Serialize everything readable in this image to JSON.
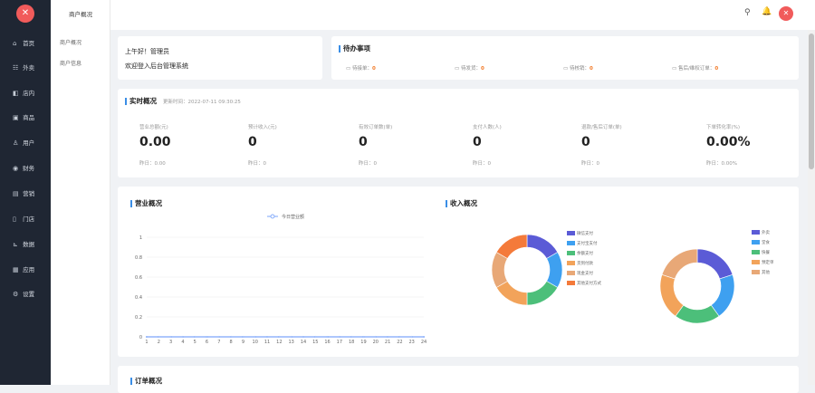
{
  "sidebar": {
    "logo_icon": "fork-knife-icon",
    "items": [
      {
        "label": "首页",
        "icon": "home-icon"
      },
      {
        "label": "外卖",
        "icon": "takeout-icon"
      },
      {
        "label": "店内",
        "icon": "store-icon"
      },
      {
        "label": "商品",
        "icon": "goods-icon"
      },
      {
        "label": "用户",
        "icon": "user-icon"
      },
      {
        "label": "财务",
        "icon": "finance-icon"
      },
      {
        "label": "营销",
        "icon": "marketing-icon"
      },
      {
        "label": "门店",
        "icon": "shop-icon"
      },
      {
        "label": "数据",
        "icon": "chart-icon"
      },
      {
        "label": "应用",
        "icon": "apps-icon"
      },
      {
        "label": "设置",
        "icon": "settings-icon"
      }
    ]
  },
  "subnav": {
    "title": "商户概况",
    "items": [
      "商户概况",
      "商户信息"
    ]
  },
  "topbar": {
    "icons": [
      "search-icon",
      "bell-icon",
      "avatar"
    ]
  },
  "welcome": {
    "greeting": "上午好！管理员",
    "message": "欢迎登入后台管理系统"
  },
  "todo": {
    "title": "待办事项",
    "items": [
      {
        "label": "待接单：",
        "value": "0"
      },
      {
        "label": "待发货：",
        "value": "0"
      },
      {
        "label": "待核销：",
        "value": "0"
      },
      {
        "label": "售后/维权订单：",
        "value": "0"
      }
    ]
  },
  "realtime": {
    "title": "实时概况",
    "updated": "更新时间：2022-07-11 09:30:25",
    "metrics": [
      {
        "label": "营业总额(元)",
        "value": "0.00",
        "compare": "昨日：0.00"
      },
      {
        "label": "预计收入(元)",
        "value": "0",
        "compare": "昨日：0"
      },
      {
        "label": "有效订单数(单)",
        "value": "0",
        "compare": "昨日：0"
      },
      {
        "label": "支付人数(人)",
        "value": "0",
        "compare": "昨日：0"
      },
      {
        "label": "退款/售后订单(单)",
        "value": "0",
        "compare": "昨日：0"
      },
      {
        "label": "下单转化率(%)",
        "value": "0.00%",
        "compare": "昨日：0.00%"
      }
    ]
  },
  "business": {
    "title": "营业概况"
  },
  "income": {
    "title": "收入概况"
  },
  "orders": {
    "title": "订单概况"
  },
  "chart_data": [
    {
      "type": "line",
      "title": "营业概况",
      "series": [
        {
          "name": "今日营业额",
          "values": [
            0,
            0,
            0,
            0,
            0,
            0,
            0,
            0,
            0,
            0,
            0,
            0,
            0,
            0,
            0,
            0,
            0,
            0,
            0,
            0,
            0,
            0,
            0,
            0
          ]
        }
      ],
      "x": [
        "1",
        "2",
        "3",
        "4",
        "5",
        "6",
        "7",
        "8",
        "9",
        "10",
        "11",
        "12",
        "13",
        "14",
        "15",
        "16",
        "17",
        "18",
        "19",
        "20",
        "21",
        "22",
        "23",
        "24"
      ],
      "yticks": [
        "0",
        "0.2",
        "0.4",
        "0.6",
        "0.8",
        "1"
      ],
      "ylim": [
        0,
        1
      ],
      "grid": true,
      "legend": "top-center",
      "color": "#5b8ff9"
    },
    {
      "type": "pie",
      "title": "收入概况",
      "legend": "right",
      "labels": [
        "微信支付",
        "支付宝支付",
        "余额支付",
        "货到付款",
        "现金支付",
        "其他支付方式"
      ],
      "values": [
        1,
        1,
        1,
        1,
        1,
        1
      ],
      "colors": [
        "#5b5bd6",
        "#3ea0f0",
        "#4cbf7a",
        "#f2a35a",
        "#e8a877",
        "#f47a3a"
      ]
    },
    {
      "type": "pie",
      "legend": "right",
      "labels": [
        "外卖",
        "堂食",
        "快餐",
        "预定单",
        "其他"
      ],
      "values": [
        1,
        1,
        1,
        1,
        1
      ],
      "colors": [
        "#5b5bd6",
        "#3ea0f0",
        "#4cbf7a",
        "#f2a35a",
        "#e8a877"
      ]
    }
  ]
}
